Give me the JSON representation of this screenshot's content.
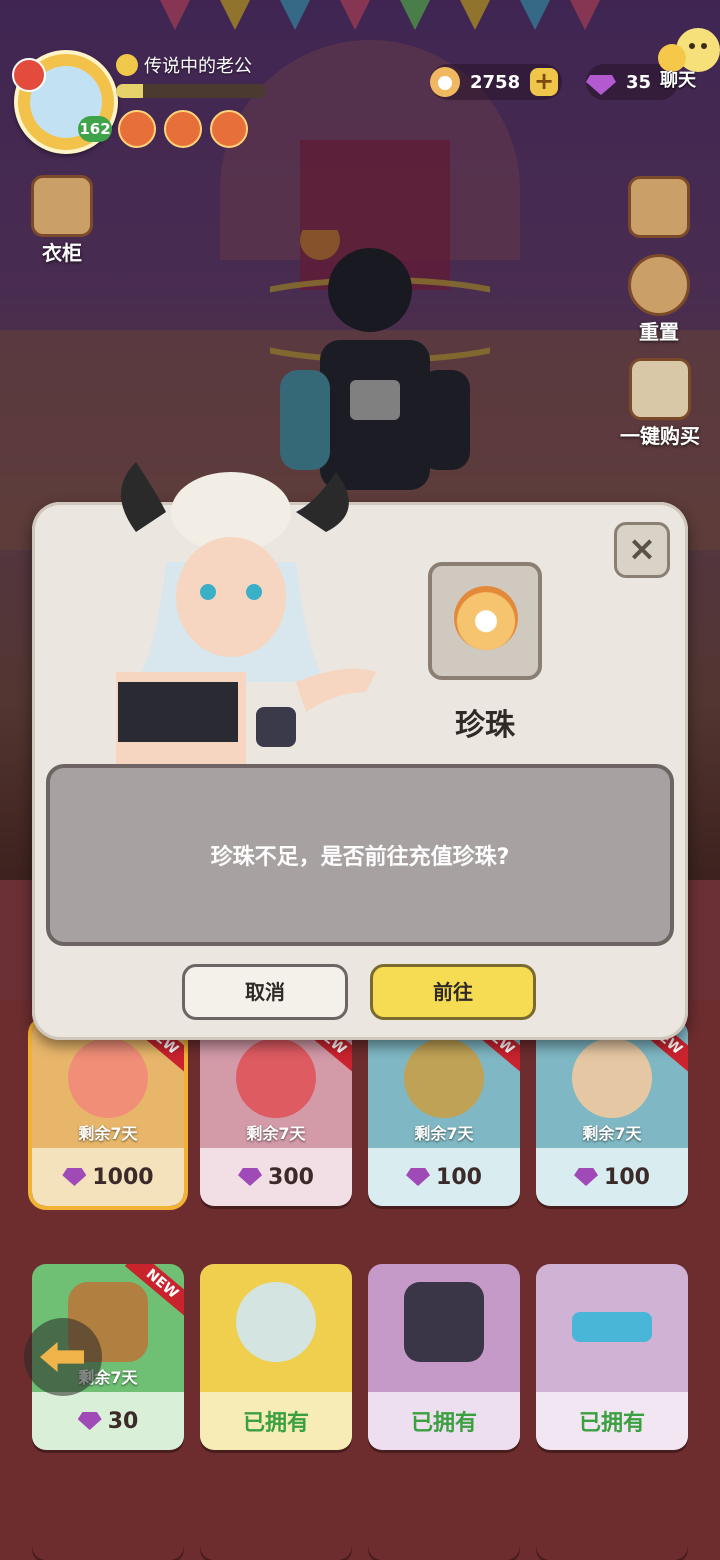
{
  "hud": {
    "player_title": "传说中的老公",
    "level": "162",
    "exp_progress": 0.18,
    "pearls": "2758",
    "gems": "35",
    "plus": "+",
    "chat_label": "聊天"
  },
  "side_menu": {
    "wardrobe": "衣柜",
    "reset": "重置",
    "buy_all": "一键购买"
  },
  "dialog": {
    "item_name": "珍珠",
    "message": "珍珠不足，是否前往充值珍珠?",
    "cancel": "取消",
    "confirm": "前往",
    "close": "×"
  },
  "shop": {
    "new_label": "NEW",
    "items": [
      {
        "remain": "剩余7天",
        "price": "1000",
        "theme": "orange",
        "new": true
      },
      {
        "remain": "剩余7天",
        "price": "300",
        "theme": "pink",
        "new": true
      },
      {
        "remain": "剩余7天",
        "price": "100",
        "theme": "blue",
        "new": true
      },
      {
        "remain": "剩余7天",
        "price": "100",
        "theme": "blue",
        "new": true
      },
      {
        "remain": "剩余7天",
        "price": "30",
        "theme": "green",
        "new": true
      },
      {
        "status": "已拥有",
        "theme": "yellow"
      },
      {
        "status": "已拥有",
        "theme": "purple"
      },
      {
        "status": "已拥有",
        "theme": "lpurple"
      }
    ]
  },
  "colors": {
    "accent": "#f6dc52",
    "owned": "#3aa040",
    "gem": "#a04ab8"
  }
}
